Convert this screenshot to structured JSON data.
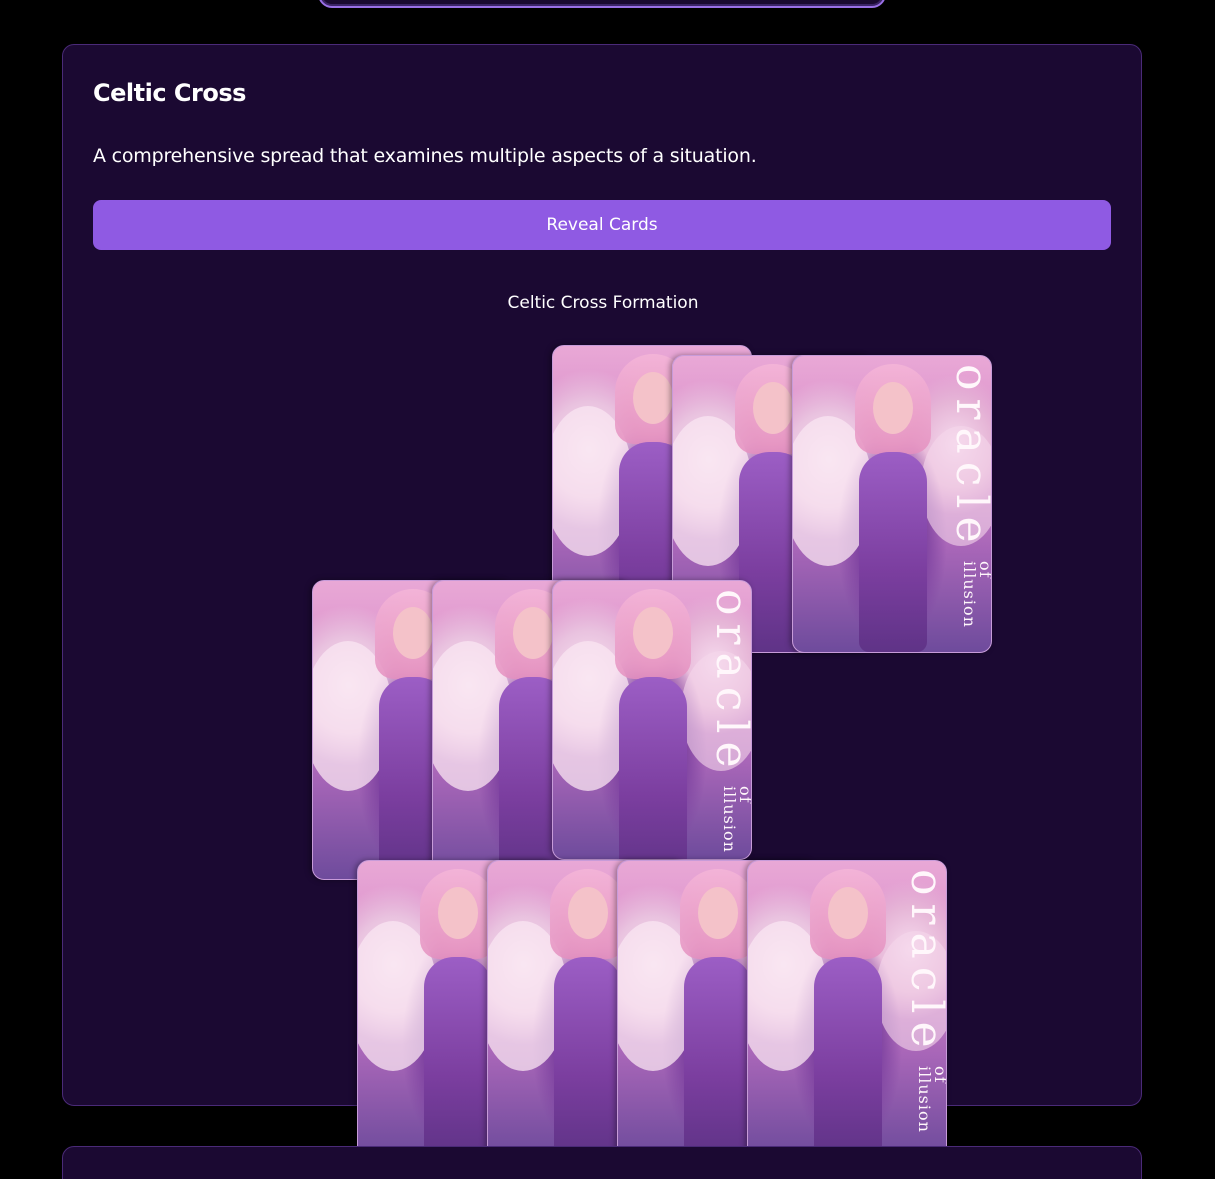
{
  "spread": {
    "title": "Celtic Cross",
    "description": "A comprehensive spread that examines multiple aspects of a situation.",
    "reveal_label": "Reveal Cards",
    "formation_title": "Celtic Cross Formation"
  },
  "card_branding": {
    "main": "oracle",
    "sub": "of illusion"
  },
  "colors": {
    "background": "#000000",
    "panel": "#1b0932",
    "panel_border": "#4a2a78",
    "button": "#8f5ae3"
  }
}
